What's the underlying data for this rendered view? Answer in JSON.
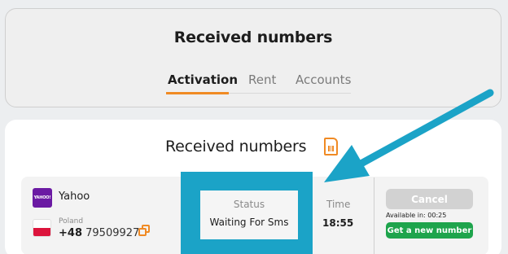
{
  "header": {
    "title": "Received numbers",
    "tabs": [
      {
        "label": "Activation",
        "active": true
      },
      {
        "label": "Rent",
        "active": false
      },
      {
        "label": "Accounts",
        "active": false
      }
    ]
  },
  "main": {
    "title": "Received numbers",
    "row": {
      "service": {
        "name": "Yahoo",
        "logo_text": "YAHOO!"
      },
      "country": "Poland",
      "phone_prefix": "+48",
      "phone_number": "795099271",
      "status_label": "Status",
      "status_value": "Waiting For Sms",
      "time_label": "Time",
      "time_value": "18:55",
      "cancel_label": "Cancel",
      "available_text": "Available in: 00:25",
      "new_number_label": "Get a new number"
    }
  },
  "colors": {
    "accent": "#f08a24",
    "highlight": "#1ba3c7",
    "success": "#1ea44c",
    "yahoo": "#6b1aa3"
  },
  "icons": [
    "sim-card-icon",
    "copy-icon",
    "poland-flag-icon",
    "yahoo-logo-icon",
    "annotation-arrow-icon"
  ]
}
